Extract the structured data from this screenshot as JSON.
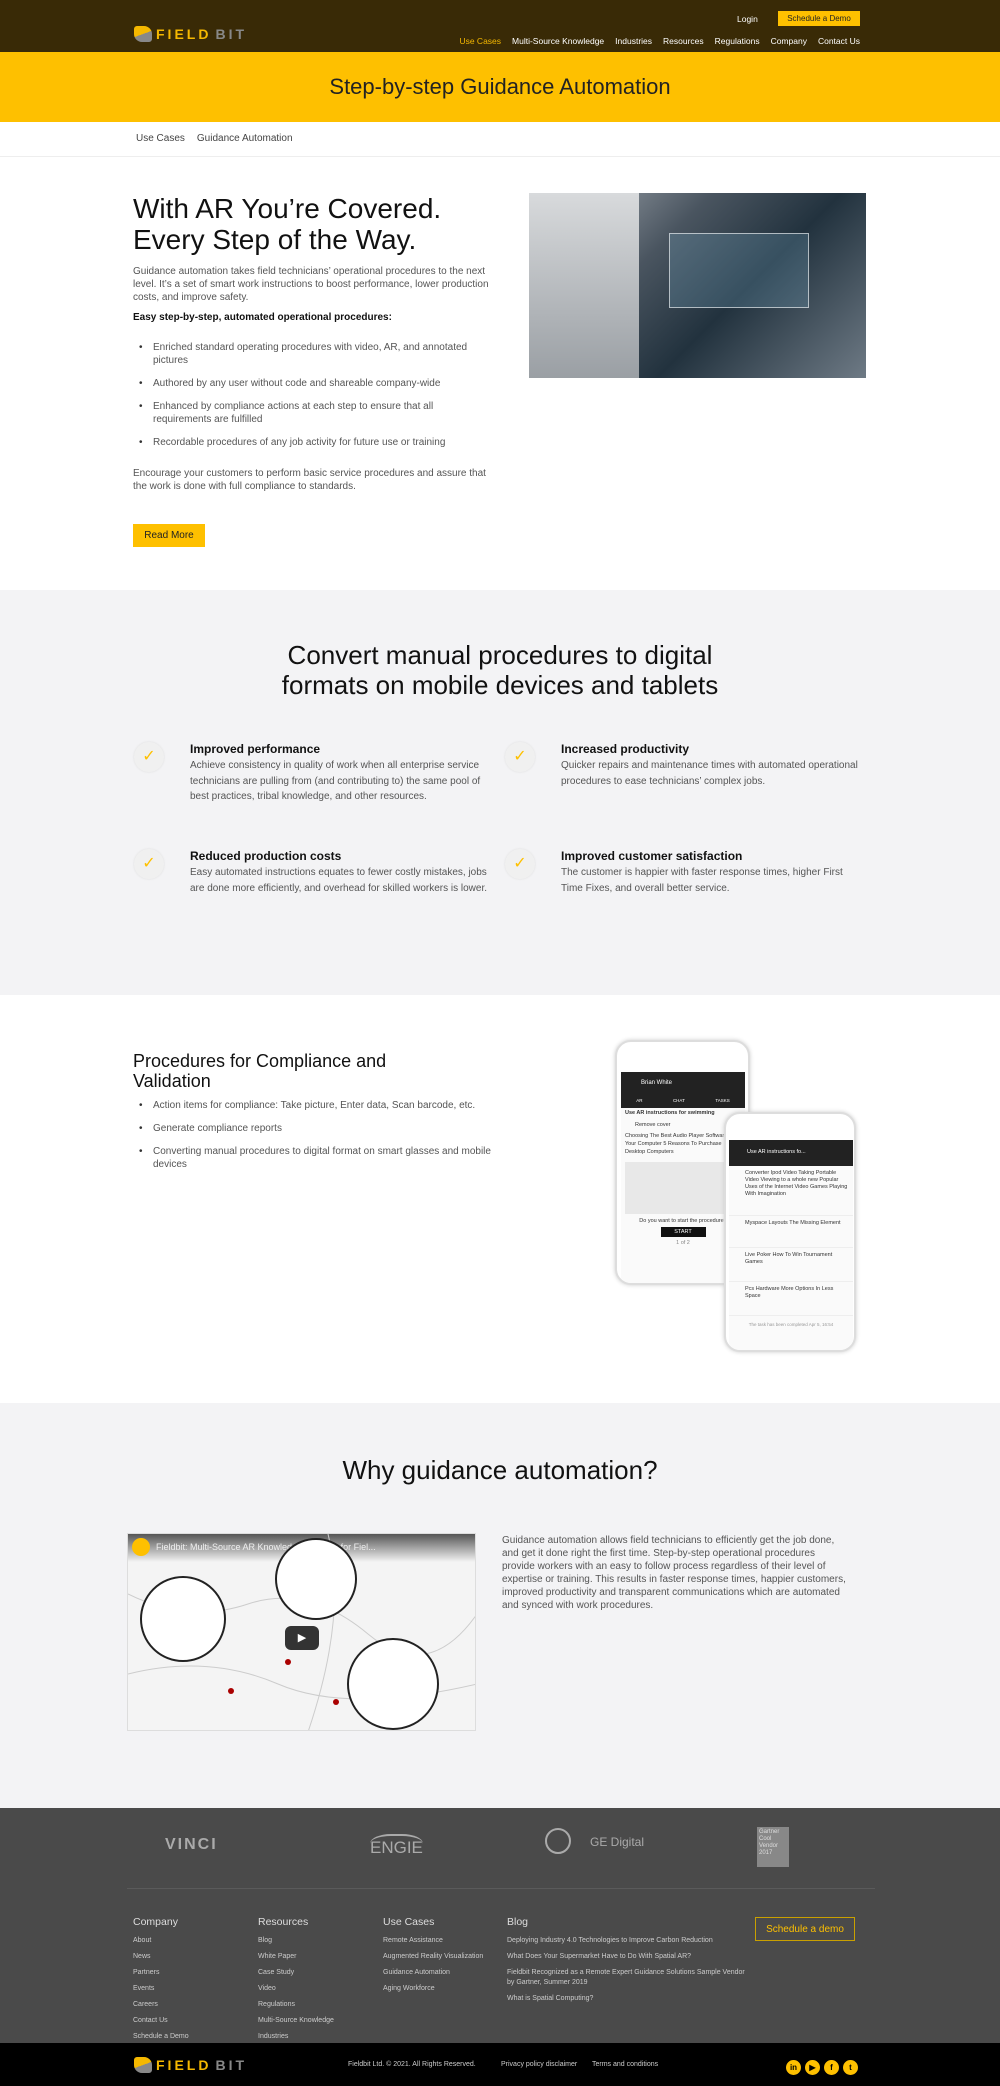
{
  "header": {
    "logo": "FIELDBIT",
    "login": "Login",
    "schedule_demo": "Schedule a Demo",
    "nav": [
      "Use Cases",
      "Multi-Source Knowledge",
      "Industries",
      "Resources",
      "Regulations",
      "Company",
      "Contact Us"
    ],
    "active_nav": "Use Cases",
    "brand_color": "#fec000"
  },
  "banner": {
    "title": "Step-by-step Guidance Automation"
  },
  "breadcrumb": [
    "Use Cases",
    "Guidance Automation"
  ],
  "hero": {
    "title_line1": "With AR You’re Covered.",
    "title_line2": "Every Step of the Way.",
    "intro": "Guidance automation takes field technicians’ operational procedures to the next level. It’s a set of smart work instructions to boost performance, lower production costs, and improve safety.",
    "subheading": "Easy step-by-step, automated operational procedures:",
    "bullets": [
      "Enriched standard operating procedures with video, AR, and annotated pictures",
      "Authored by any user without code and shareable company-wide",
      "Enhanced by compliance actions at each step to ensure that all requirements are fulfilled",
      "Recordable procedures of any job activity for future use or training"
    ],
    "outro": "Encourage your customers to perform basic service procedures and assure that the work is done with full compliance to standards.",
    "read_more": "Read More"
  },
  "convert": {
    "title_line1": "Convert manual procedures to digital",
    "title_line2": "formats on mobile devices and tablets",
    "features": [
      {
        "title": "Improved performance",
        "text": "Achieve consistency in quality of work when all enterprise service technicians are pulling from (and contributing to) the same pool of best practices, tribal knowledge, and other resources."
      },
      {
        "title": "Increased productivity",
        "text": "Quicker repairs and maintenance times with automated operational procedures to ease technicians’ complex jobs."
      },
      {
        "title": "Reduced production costs",
        "text": "Easy automated instructions equates to fewer costly mistakes, jobs are done more efficiently, and overhead for skilled workers is lower."
      },
      {
        "title": "Improved customer satisfaction",
        "text": "The customer is happier with faster response times, higher First Time Fixes, and overall better service."
      }
    ]
  },
  "compliance": {
    "title": "Procedures for Compliance and Validation",
    "bullets": [
      "Action items for compliance: Take picture, Enter data, Scan barcode, etc.",
      "Generate compliance reports",
      "Converting manual procedures to digital format on smart glasses and mobile devices"
    ],
    "phone1": {
      "name": "Brian White",
      "tabs": [
        "AR",
        "CHAT",
        "TASKS"
      ],
      "task": "Use AR instructions for swimming",
      "step": "Remove cover",
      "desc": "Choosing The Best Audio Player Software For Your Computer 5 Reasons To Purchase Desktop Computers",
      "prompt": "Do you want to start the procedure?",
      "start": "START",
      "pager": "1 of 2"
    },
    "phone2": {
      "title": "Use AR instructions fo...",
      "items": [
        "Converter Ipod Video Taking Portable Video Viewing to a whole new Popular Uses of the Internet Video Games Playing With Imagination",
        "Myspace Layouts The Missing Element",
        "Live Poker How To Win Tournament Games",
        "Pcs Hardware More Options In Less Space"
      ],
      "footer": "The task has been completed Apr 5, 16:54"
    }
  },
  "why": {
    "title": "Why guidance automation?",
    "video_title": "Fieldbit: Multi-Source AR Knowledge Platform for Fiel...",
    "text": "Guidance automation allows field technicians to efficiently get the job done, and get it done right the first time. Step-by-step operational procedures provide workers with an easy to follow process regardless of their level of expertise or training. This results in faster response times, happier customers, improved productivity and transparent communications which are automated and synced with work procedures."
  },
  "footer": {
    "logos": [
      "VINCI",
      "ENGIE",
      "GE Digital",
      "Gartner Cool Vendor 2017"
    ],
    "columns": [
      {
        "title": "Company",
        "links": [
          "About",
          "News",
          "Partners",
          "Events",
          "Careers",
          "Contact Us",
          "Schedule a Demo"
        ]
      },
      {
        "title": "Resources",
        "links": [
          "Blog",
          "White Paper",
          "Case Study",
          "Video",
          "Regulations",
          "Multi-Source Knowledge",
          "Industries"
        ]
      },
      {
        "title": "Use Cases",
        "links": [
          "Remote Assistance",
          "Augmented Reality Visualization",
          "Guidance Automation",
          "Aging Workforce"
        ]
      },
      {
        "title": "Blog",
        "links": [
          "Deploying Industry 4.0 Technologies to Improve Carbon Reduction",
          "What Does Your Supermarket Have to Do With Spatial AR?",
          "Fieldbit Recognized as a Remote Expert Guidance Solutions Sample Vendor by Gartner, Summer 2019",
          "What is Spatial Computing?"
        ]
      }
    ],
    "schedule_demo": "Schedule a demo"
  },
  "bottom": {
    "logo": "FIELDBIT",
    "copyright": "Fieldbit Ltd. © 2021. All Rights Reserved.",
    "privacy": "Privacy policy disclaimer",
    "terms": "Terms and conditions",
    "social": [
      "linkedin-icon",
      "youtube-icon",
      "facebook-icon",
      "twitter-icon"
    ]
  }
}
